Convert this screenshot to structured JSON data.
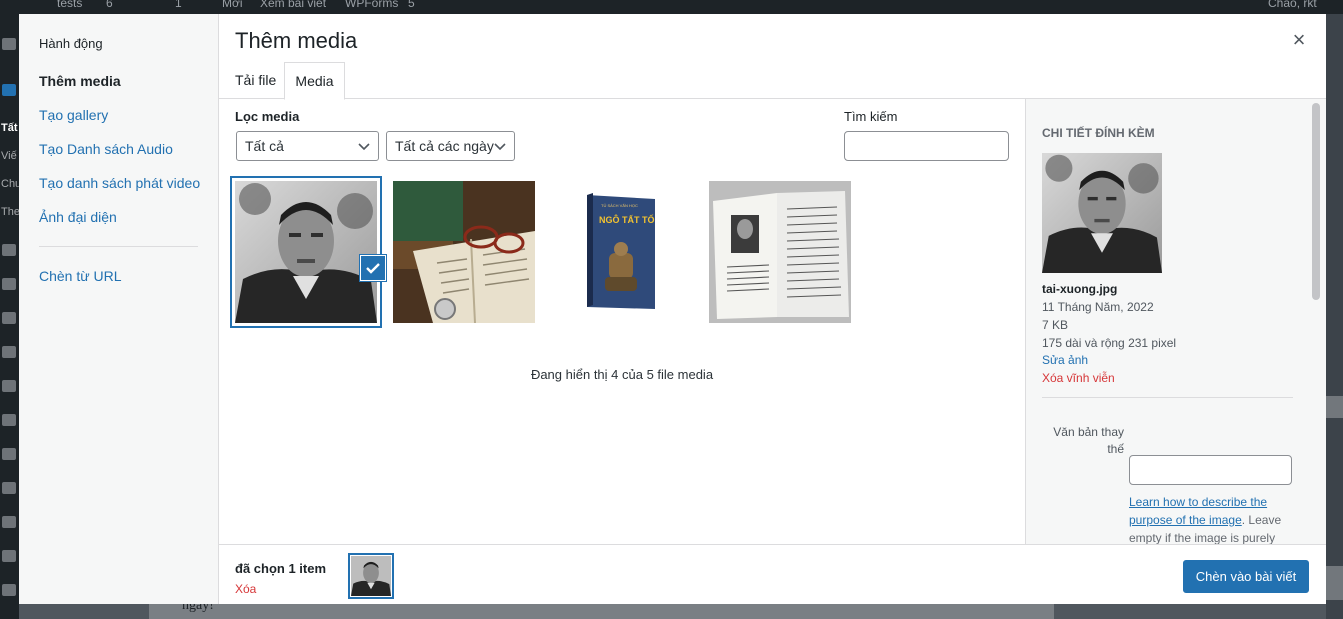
{
  "admin_bar": {
    "site": "tests",
    "updates": "6",
    "comments": "1",
    "new": "Mới",
    "view": "Xem bài viết",
    "wpforms": "WPForms",
    "wpforms_count": "5",
    "greeting": "Chào, rkt"
  },
  "background": {
    "menu_fragments": [
      "Tất",
      "Viế",
      "Chu",
      "The"
    ],
    "editor_text": "ngày!"
  },
  "menu": {
    "heading": "Hành động",
    "items": [
      {
        "label": "Thêm media",
        "active": true
      },
      {
        "label": "Tạo gallery"
      },
      {
        "label": "Tạo Danh sách Audio"
      },
      {
        "label": "Tạo danh sách phát video"
      },
      {
        "label": "Ảnh đại diện"
      },
      {
        "label": "Chèn từ URL"
      }
    ]
  },
  "frame": {
    "title": "Thêm media",
    "close_glyph": "×",
    "tabs": [
      {
        "label": "Tải file"
      },
      {
        "label": "Media",
        "active": true
      }
    ]
  },
  "filters": {
    "label": "Lọc media",
    "type_value": "Tất cả",
    "date_value": "Tất cả các ngày",
    "search_label": "Tìm kiếm",
    "search_value": ""
  },
  "attachments": [
    {
      "name": "portrait-photo",
      "selected": true
    },
    {
      "name": "books-glasses"
    },
    {
      "name": "book-cover"
    },
    {
      "name": "open-book"
    }
  ],
  "cover_text": {
    "top": "TỦ SÁCH VĂN HỌC",
    "title": "NGÔ TẤT TỐ"
  },
  "media_count_text": "Đang hiển thị 4 của 5 file media",
  "details": {
    "heading": "Chi tiết đính kèm",
    "filename": "tai-xuong.jpg",
    "date": "11 Tháng Năm, 2022",
    "size": "7 KB",
    "dimensions": "175 dài và rộng 231 pixel",
    "edit_label": "Sửa ảnh",
    "delete_label": "Xóa vĩnh viễn",
    "alt_label": "Văn bản thay thế",
    "alt_value": "",
    "help_link": "Learn how to describe the purpose of the image",
    "help_text": ". Leave empty if the image is purely"
  },
  "selection": {
    "count_text": "đã chọn 1 item",
    "clear_label": "Xóa"
  },
  "insert_button": "Chèn vào bài viết",
  "colors": {
    "accent": "#2271b1",
    "danger": "#d63638",
    "text": "#1d2327"
  },
  "icons": {
    "check": "check-icon",
    "chevron": "chevron-down-icon",
    "close": "close-icon"
  }
}
